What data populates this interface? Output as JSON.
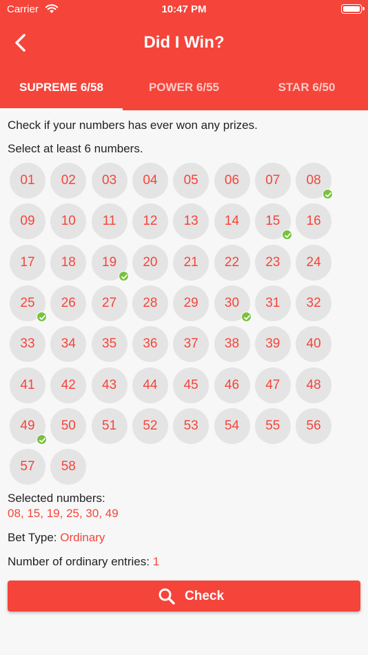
{
  "status_bar": {
    "carrier": "Carrier",
    "time": "10:47 PM"
  },
  "nav": {
    "title": "Did I Win?"
  },
  "tabs": [
    {
      "label": "SUPREME 6/58",
      "active": true
    },
    {
      "label": "POWER 6/55",
      "active": false
    },
    {
      "label": "STAR 6/50",
      "active": false
    }
  ],
  "intro": "Check if your numbers has ever won any prizes.",
  "select_hint": "Select at least 6 numbers.",
  "numbers": [
    "01",
    "02",
    "03",
    "04",
    "05",
    "06",
    "07",
    "08",
    "09",
    "10",
    "11",
    "12",
    "13",
    "14",
    "15",
    "16",
    "17",
    "18",
    "19",
    "20",
    "21",
    "22",
    "23",
    "24",
    "25",
    "26",
    "27",
    "28",
    "29",
    "30",
    "31",
    "32",
    "33",
    "34",
    "35",
    "36",
    "37",
    "38",
    "39",
    "40",
    "41",
    "42",
    "43",
    "44",
    "45",
    "46",
    "47",
    "48",
    "49",
    "50",
    "51",
    "52",
    "53",
    "54",
    "55",
    "56",
    "57",
    "58"
  ],
  "selected": [
    "08",
    "15",
    "19",
    "25",
    "30",
    "49"
  ],
  "selected_label": "Selected numbers:",
  "selected_value": "08, 15, 19, 25, 30, 49",
  "bet_type_label": "Bet Type:",
  "bet_type_value": "Ordinary",
  "entries_label": "Number of ordinary entries:",
  "entries_value": "1",
  "check_button": "Check",
  "colors": {
    "accent": "#f5443a",
    "ball": "#e4e4e4",
    "check": "#79c23d"
  }
}
